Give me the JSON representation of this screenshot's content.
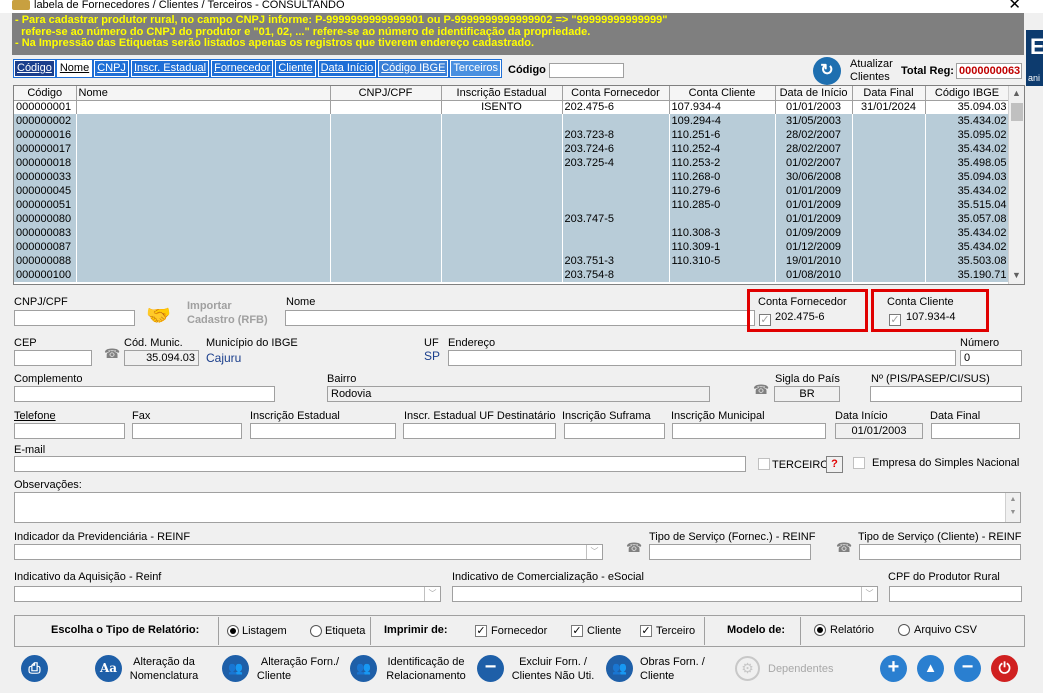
{
  "window": {
    "title": "labela de Fornecedores / Clientes / Terceiros  -  CONSULTANDO",
    "close": "✕"
  },
  "banner": {
    "line1": "- Para cadastrar produtor rural, no campo CNPJ informe: P-9999999999999901 ou P-9999999999999902 => \"99999999999999\"",
    "line2": "  refere-se ao número do CNPJ do produtor e \"01, 02, ...\" refere-se ao número de identificação da propriedade.",
    "line3": "- Na Impressão das Etiquetas serão listados apenas os registros que tiverem endereço cadastrado."
  },
  "right_strip": {
    "glyph": "E",
    "text": "ani"
  },
  "tabs": [
    "Código",
    "Nome",
    "CNPJ",
    "Inscr. Estadual",
    "Fornecedor",
    "Cliente",
    "Data Início",
    "Código IBGE",
    "Terceiros"
  ],
  "search": {
    "label": "Código",
    "value": ""
  },
  "refresh": {
    "label1": "Atualizar",
    "label2": "Clientes"
  },
  "total": {
    "label": "Total Reg:",
    "value": "0000000063"
  },
  "grid": {
    "columns": [
      "Código",
      "Nome",
      "CNPJ/CPF",
      "Inscrição Estadual",
      "Conta Fornecedor",
      "Conta Cliente",
      "Data de Início",
      "Data Final",
      "Código IBGE"
    ],
    "rows": [
      [
        "000000001",
        "",
        "",
        "ISENTO",
        "202.475-6",
        "107.934-4",
        "01/01/2003",
        "31/01/2024",
        "35.094.03"
      ],
      [
        "000000002",
        "",
        "",
        "",
        "",
        "109.294-4",
        "31/05/2003",
        "",
        "35.434.02"
      ],
      [
        "000000016",
        "",
        "",
        "",
        "203.723-8",
        "110.251-6",
        "28/02/2007",
        "",
        "35.095.02"
      ],
      [
        "000000017",
        "",
        "",
        "",
        "203.724-6",
        "110.252-4",
        "28/02/2007",
        "",
        "35.434.02"
      ],
      [
        "000000018",
        "",
        "",
        "",
        "203.725-4",
        "110.253-2",
        "01/02/2007",
        "",
        "35.498.05"
      ],
      [
        "000000033",
        "",
        "",
        "",
        "",
        "110.268-0",
        "30/06/2008",
        "",
        "35.094.03"
      ],
      [
        "000000045",
        "",
        "",
        "",
        "",
        "110.279-6",
        "01/01/2009",
        "",
        "35.434.02"
      ],
      [
        "000000051",
        "",
        "",
        "",
        "",
        "110.285-0",
        "01/01/2009",
        "",
        "35.515.04"
      ],
      [
        "000000080",
        "",
        "",
        "",
        "203.747-5",
        "",
        "01/01/2009",
        "",
        "35.057.08"
      ],
      [
        "000000083",
        "",
        "",
        "",
        "",
        "110.308-3",
        "01/09/2009",
        "",
        "35.434.02"
      ],
      [
        "000000087",
        "",
        "",
        "",
        "",
        "110.309-1",
        "01/12/2009",
        "",
        "35.434.02"
      ],
      [
        "000000088",
        "",
        "",
        "",
        "203.751-3",
        "110.310-5",
        "19/01/2010",
        "",
        "35.503.08"
      ],
      [
        "000000100",
        "",
        "",
        "",
        "203.754-8",
        "",
        "01/08/2010",
        "",
        "35.190.71"
      ]
    ]
  },
  "form": {
    "cnpj_label": "CNPJ/CPF",
    "import_label1": "Importar",
    "import_label2": "Cadastro (RFB)",
    "nome_label": "Nome",
    "conta_fornecedor_label": "Conta Fornecedor",
    "conta_fornecedor_value": "202.475-6",
    "conta_cliente_label": "Conta Cliente",
    "conta_cliente_value": "107.934-4",
    "cep_label": "CEP",
    "cod_munic_label": "Cód. Munic.",
    "cod_munic_value": "35.094.03",
    "municipio_label": "Município do IBGE",
    "municipio_value": "Cajuru",
    "uf_label": "UF",
    "uf_value": "SP",
    "endereco_label": "Endereço",
    "numero_label": "Número",
    "numero_value": "0",
    "complemento_label": "Complemento",
    "bairro_label": "Bairro",
    "bairro_value": "Rodovia",
    "sigla_pais_label": "Sigla do País",
    "sigla_pais_value": "BR",
    "nis_label": "Nº (PIS/PASEP/CI/SUS)",
    "telefone_label": "Telefone",
    "fax_label": "Fax",
    "insc_est_label": "Inscrição Estadual",
    "insc_est_uf_label": "Inscr. Estadual UF Destinatário",
    "insc_suframa_label": "Inscrição Suframa",
    "insc_mun_label": "Inscrição Municipal",
    "data_inicio_label": "Data Início",
    "data_inicio_value": "01/01/2003",
    "data_final_label": "Data Final",
    "email_label": "E-mail",
    "terceiro_label": "TERCEIRO",
    "help_glyph": "?",
    "simples_label": "Empresa do Simples Nacional",
    "obs_label": "Observações:",
    "reinf_label": "Indicador da Previdenciária - REINF",
    "tipo_forn_label": "Tipo de Serviço (Fornec.) - REINF",
    "tipo_cli_label": "Tipo de Serviço (Cliente) - REINF",
    "aquisicao_label": "Indicativo da Aquisição - Reinf",
    "comercializacao_label": "Indicativo de Comercialização - eSocial",
    "cpf_produtor_label": "CPF do Produtor Rural"
  },
  "report": {
    "tipo_label": "Escolha o Tipo de Relatório:",
    "listagem": "Listagem",
    "etiqueta": "Etiqueta",
    "imprimir_label": "Imprimir de:",
    "fornecedor": "Fornecedor",
    "cliente": "Cliente",
    "terceiro": "Terceiro",
    "modelo_label": "Modelo de:",
    "relatorio": "Relatório",
    "arquivo_csv": "Arquivo CSV"
  },
  "buttons": {
    "alt_nom_1": "Alteração da",
    "alt_nom_2": "Nomenclatura",
    "alt_forn_1": "Alteração Forn./",
    "alt_forn_2": "Cliente",
    "ident_1": "Identificação de",
    "ident_2": "Relacionamento",
    "excluir_1": "Excluir Forn. /",
    "excluir_2": "Clientes Não Uti.",
    "obras_1": "Obras Forn. /",
    "obras_2": "Cliente",
    "dependentes": "Dependentes",
    "aa": "Aa"
  },
  "colors": {
    "banner_bg": "#7f7f7f",
    "banner_text": "#ffff00",
    "tab_blue": "#1f6fd6",
    "grid_row": "#b8ccd8",
    "highlight": "#e00000",
    "total_text": "#c00000",
    "power_button": "#d02020"
  }
}
